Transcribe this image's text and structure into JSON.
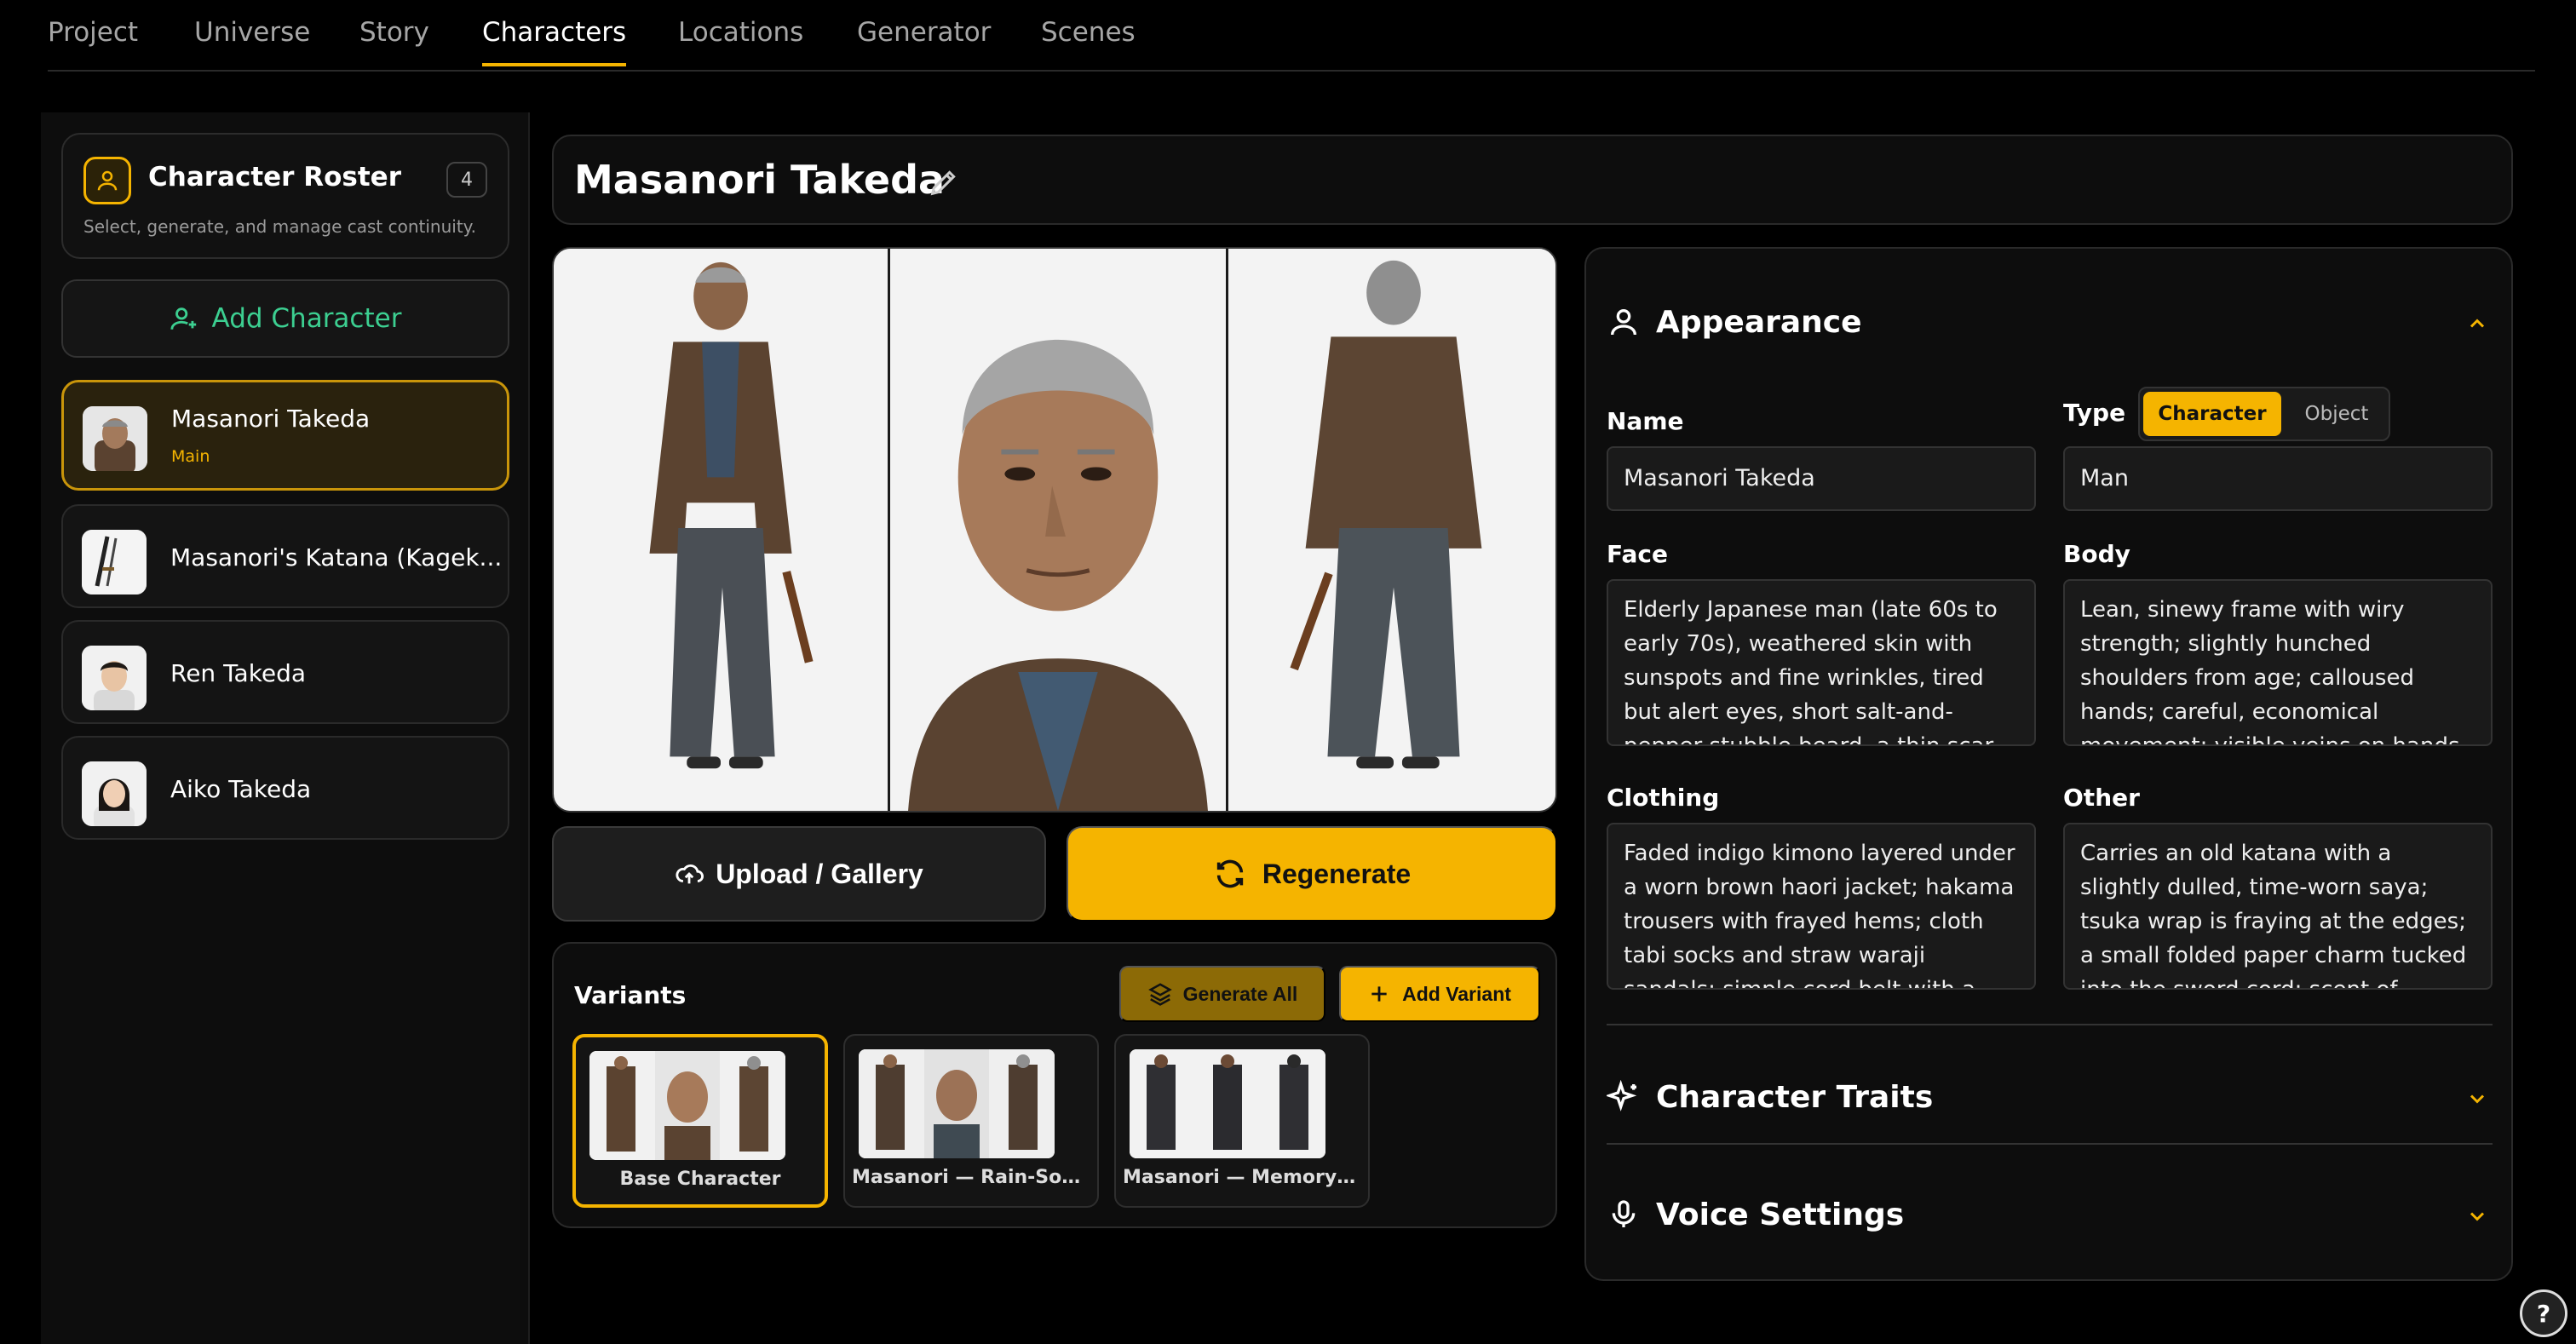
{
  "nav": {
    "tabs": [
      {
        "label": "Project"
      },
      {
        "label": "Universe"
      },
      {
        "label": "Story"
      },
      {
        "label": "Characters"
      },
      {
        "label": "Locations"
      },
      {
        "label": "Generator"
      },
      {
        "label": "Scenes"
      }
    ],
    "active_index": 3
  },
  "sidebar": {
    "roster_title": "Character Roster",
    "roster_count": "4",
    "roster_subtitle": "Select, generate, and manage cast continuity.",
    "add_character_label": "Add Character",
    "characters": [
      {
        "name": "Masanori Takeda",
        "tag": "Main",
        "selected": true
      },
      {
        "name": "Masanori's Katana (Kagek...",
        "tag": "",
        "selected": false
      },
      {
        "name": "Ren Takeda",
        "tag": "",
        "selected": false
      },
      {
        "name": "Aiko Takeda",
        "tag": "",
        "selected": false
      }
    ]
  },
  "main": {
    "title": "Masanori Takeda",
    "upload_label": "Upload / Gallery",
    "regenerate_label": "Regenerate"
  },
  "variants": {
    "title": "Variants",
    "generate_all_label": "Generate All",
    "add_variant_label": "Add Variant",
    "items": [
      {
        "label": "Base Character",
        "selected": true
      },
      {
        "label": "Masanori — Rain-Soa...",
        "selected": false
      },
      {
        "label": "Masanori — Memory ...",
        "selected": false
      }
    ]
  },
  "appearance": {
    "section_title": "Appearance",
    "name_label": "Name",
    "name_value": "Masanori Takeda",
    "type_label": "Type",
    "type_options": [
      "Character",
      "Object"
    ],
    "type_selected": "Character",
    "type_value": "Man",
    "face_label": "Face",
    "face_value": "Elderly Japanese man (late 60s to early 70s), weathered skin with sunspots and fine wrinkles, tired but alert eyes, short salt-and-pepper stubble beard, a thin scar running",
    "body_label": "Body",
    "body_value": "Lean, sinewy frame with wiry strength; slightly hunched shoulders from age; calloused hands; careful, economical movement; visible veins on hands and forearms",
    "clothing_label": "Clothing",
    "clothing_value": "Faded indigo kimono layered under a worn brown haori jacket; hakama trousers with frayed hems; cloth tabi socks and straw waraji sandals; simple cord belt with a lacquered",
    "other_label": "Other",
    "other_value": "Carries an old katana with a slightly dulled, time-worn saya; tsuka wrap is fraying at the edges; a small folded paper charm tucked into the sword cord; scent of smoke"
  },
  "traits": {
    "section_title": "Character Traits"
  },
  "voice": {
    "section_title": "Voice Settings"
  },
  "help_label": "?",
  "colors": {
    "accent": "#f5b400",
    "add_green": "#3ccf91",
    "background": "#000000"
  }
}
